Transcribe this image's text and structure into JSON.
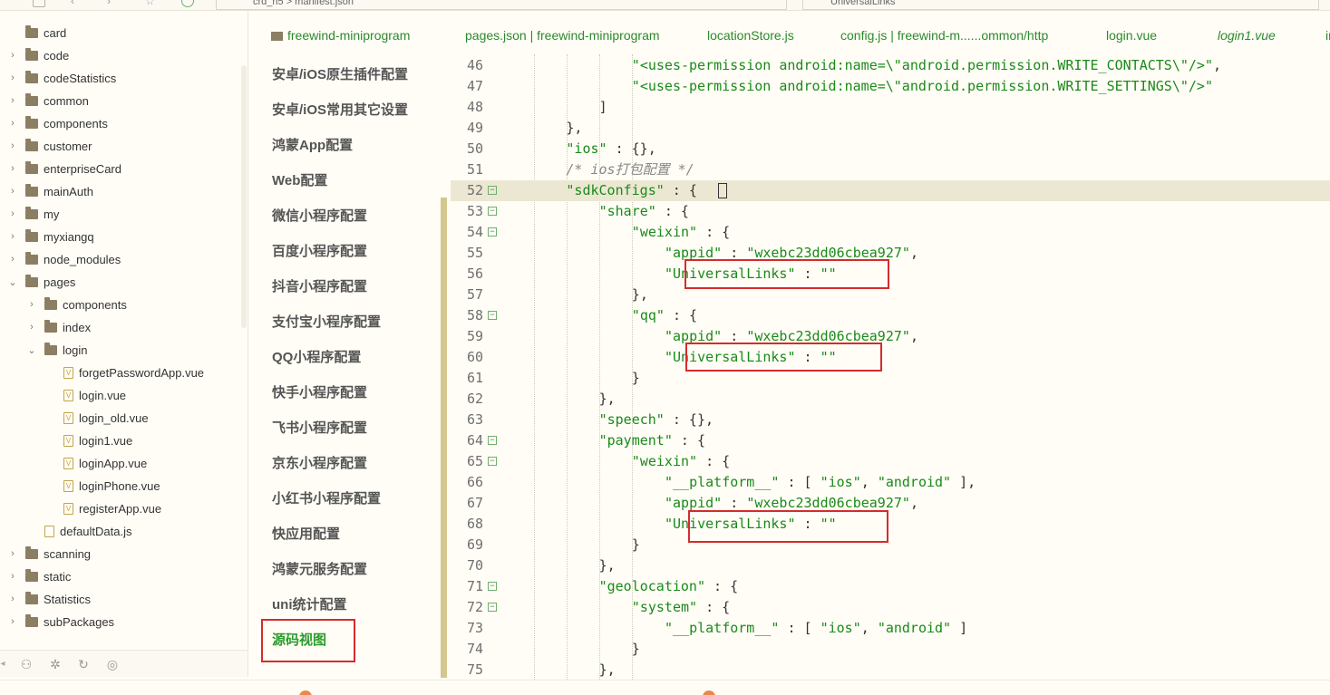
{
  "topbar": {
    "crumb": "crd_h5  >  manifest.json",
    "search": "UniversalLinks"
  },
  "tree": {
    "items": [
      {
        "label": "card",
        "type": "folder",
        "indent": 1,
        "expanded": null
      },
      {
        "label": "code",
        "type": "folder",
        "indent": 1,
        "expanded": false
      },
      {
        "label": "codeStatistics",
        "type": "folder",
        "indent": 1,
        "expanded": false
      },
      {
        "label": "common",
        "type": "folder",
        "indent": 1,
        "expanded": false
      },
      {
        "label": "components",
        "type": "folder",
        "indent": 1,
        "expanded": false
      },
      {
        "label": "customer",
        "type": "folder",
        "indent": 1,
        "expanded": false
      },
      {
        "label": "enterpriseCard",
        "type": "folder",
        "indent": 1,
        "expanded": false
      },
      {
        "label": "mainAuth",
        "type": "folder",
        "indent": 1,
        "expanded": false
      },
      {
        "label": "my",
        "type": "folder",
        "indent": 1,
        "expanded": false
      },
      {
        "label": "myxiangq",
        "type": "folder",
        "indent": 1,
        "expanded": false
      },
      {
        "label": "node_modules",
        "type": "folder",
        "indent": 1,
        "expanded": false
      },
      {
        "label": "pages",
        "type": "folder",
        "indent": 1,
        "expanded": true
      },
      {
        "label": "components",
        "type": "folder",
        "indent": 2,
        "expanded": false
      },
      {
        "label": "index",
        "type": "folder",
        "indent": 2,
        "expanded": false
      },
      {
        "label": "login",
        "type": "folder",
        "indent": 2,
        "expanded": true
      },
      {
        "label": "forgetPasswordApp.vue",
        "type": "file",
        "indent": 3,
        "expanded": null
      },
      {
        "label": "login.vue",
        "type": "file",
        "indent": 3,
        "expanded": null
      },
      {
        "label": "login_old.vue",
        "type": "file",
        "indent": 3,
        "expanded": null
      },
      {
        "label": "login1.vue",
        "type": "file",
        "indent": 3,
        "expanded": null
      },
      {
        "label": "loginApp.vue",
        "type": "file",
        "indent": 3,
        "expanded": null
      },
      {
        "label": "loginPhone.vue",
        "type": "file",
        "indent": 3,
        "expanded": null
      },
      {
        "label": "registerApp.vue",
        "type": "file",
        "indent": 3,
        "expanded": null
      },
      {
        "label": "defaultData.js",
        "type": "file",
        "indent": 2,
        "expanded": null
      },
      {
        "label": "scanning",
        "type": "folder",
        "indent": 1,
        "expanded": false
      },
      {
        "label": "static",
        "type": "folder",
        "indent": 1,
        "expanded": false
      },
      {
        "label": "Statistics",
        "type": "folder",
        "indent": 1,
        "expanded": false
      },
      {
        "label": "subPackages",
        "type": "folder",
        "indent": 1,
        "expanded": false
      }
    ]
  },
  "tabs": [
    {
      "label": "freewind-miniprogram",
      "italic": false,
      "icon": "folder-icon"
    },
    {
      "label": "pages.json | freewind-miniprogram",
      "italic": false,
      "icon": null
    },
    {
      "label": "locationStore.js",
      "italic": false,
      "icon": null
    },
    {
      "label": "config.js | freewind-m......ommon/http",
      "italic": false,
      "icon": null
    },
    {
      "label": "login.vue",
      "italic": false,
      "icon": null
    },
    {
      "label": "login1.vue",
      "italic": true,
      "icon": null
    },
    {
      "label": "in",
      "italic": false,
      "icon": null
    }
  ],
  "nav": {
    "items": [
      "安卓/iOS原生插件配置",
      "安卓/iOS常用其它设置",
      "鸿蒙App配置",
      "Web配置",
      "微信小程序配置",
      "百度小程序配置",
      "抖音小程序配置",
      "支付宝小程序配置",
      "QQ小程序配置",
      "快手小程序配置",
      "飞书小程序配置",
      "京东小程序配置",
      "小红书小程序配置",
      "快应用配置",
      "鸿蒙元服务配置",
      "uni统计配置",
      "源码视图"
    ],
    "active": "源码视图"
  },
  "editor": {
    "lines": [
      {
        "n": "46",
        "fold": false,
        "hl": false,
        "indent": 5,
        "segs": [
          [
            "s",
            "\"<uses-permission android:name=\\\"android.permission.WRITE_CONTACTS\\\"/>\""
          ],
          [
            "p",
            ","
          ]
        ]
      },
      {
        "n": "47",
        "fold": false,
        "hl": false,
        "indent": 5,
        "segs": [
          [
            "s",
            "\"<uses-permission android:name=\\\"android.permission.WRITE_SETTINGS\\\"/>\""
          ]
        ]
      },
      {
        "n": "48",
        "fold": false,
        "hl": false,
        "indent": 4,
        "segs": [
          [
            "p",
            "]"
          ]
        ]
      },
      {
        "n": "49",
        "fold": false,
        "hl": false,
        "indent": 3,
        "segs": [
          [
            "p",
            "},"
          ]
        ]
      },
      {
        "n": "50",
        "fold": false,
        "hl": false,
        "indent": 3,
        "segs": [
          [
            "s",
            "\"ios\""
          ],
          [
            "p",
            " : {},"
          ]
        ]
      },
      {
        "n": "51",
        "fold": false,
        "hl": false,
        "indent": 3,
        "segs": [
          [
            "c",
            "/* ios打包配置 */"
          ]
        ]
      },
      {
        "n": "52",
        "fold": true,
        "hl": true,
        "indent": 3,
        "segs": [
          [
            "s",
            "\"sdkConfigs\""
          ],
          [
            "p",
            " : {"
          ]
        ]
      },
      {
        "n": "53",
        "fold": true,
        "hl": false,
        "indent": 4,
        "segs": [
          [
            "s",
            "\"share\""
          ],
          [
            "p",
            " : {"
          ]
        ]
      },
      {
        "n": "54",
        "fold": true,
        "hl": false,
        "indent": 5,
        "segs": [
          [
            "s",
            "\"weixin\""
          ],
          [
            "p",
            " : {"
          ]
        ]
      },
      {
        "n": "55",
        "fold": false,
        "hl": false,
        "indent": 6,
        "segs": [
          [
            "s",
            "\"appid\""
          ],
          [
            "p",
            " : "
          ],
          [
            "s",
            "\"wxebc23dd06cbea927\""
          ],
          [
            "p",
            ","
          ]
        ]
      },
      {
        "n": "56",
        "fold": false,
        "hl": false,
        "indent": 6,
        "segs": [
          [
            "s",
            "\"UniversalLinks\""
          ],
          [
            "p",
            " : "
          ],
          [
            "s",
            "\"\""
          ]
        ]
      },
      {
        "n": "57",
        "fold": false,
        "hl": false,
        "indent": 5,
        "segs": [
          [
            "p",
            "},"
          ]
        ]
      },
      {
        "n": "58",
        "fold": true,
        "hl": false,
        "indent": 5,
        "segs": [
          [
            "s",
            "\"qq\""
          ],
          [
            "p",
            " : {"
          ]
        ]
      },
      {
        "n": "59",
        "fold": false,
        "hl": false,
        "indent": 6,
        "segs": [
          [
            "s",
            "\"appid\""
          ],
          [
            "p",
            " : "
          ],
          [
            "s",
            "\"wxebc23dd06cbea927\""
          ],
          [
            "p",
            ","
          ]
        ]
      },
      {
        "n": "60",
        "fold": false,
        "hl": false,
        "indent": 6,
        "segs": [
          [
            "s",
            "\"UniversalLinks\""
          ],
          [
            "p",
            " : "
          ],
          [
            "s",
            "\"\""
          ]
        ]
      },
      {
        "n": "61",
        "fold": false,
        "hl": false,
        "indent": 5,
        "segs": [
          [
            "p",
            "}"
          ]
        ]
      },
      {
        "n": "62",
        "fold": false,
        "hl": false,
        "indent": 4,
        "segs": [
          [
            "p",
            "},"
          ]
        ]
      },
      {
        "n": "63",
        "fold": false,
        "hl": false,
        "indent": 4,
        "segs": [
          [
            "s",
            "\"speech\""
          ],
          [
            "p",
            " : {},"
          ]
        ]
      },
      {
        "n": "64",
        "fold": true,
        "hl": false,
        "indent": 4,
        "segs": [
          [
            "s",
            "\"payment\""
          ],
          [
            "p",
            " : {"
          ]
        ]
      },
      {
        "n": "65",
        "fold": true,
        "hl": false,
        "indent": 5,
        "segs": [
          [
            "s",
            "\"weixin\""
          ],
          [
            "p",
            " : {"
          ]
        ]
      },
      {
        "n": "66",
        "fold": false,
        "hl": false,
        "indent": 6,
        "segs": [
          [
            "s",
            "\"__platform__\""
          ],
          [
            "p",
            " : [ "
          ],
          [
            "s",
            "\"ios\""
          ],
          [
            "p",
            ", "
          ],
          [
            "s",
            "\"android\""
          ],
          [
            "p",
            " ],"
          ]
        ]
      },
      {
        "n": "67",
        "fold": false,
        "hl": false,
        "indent": 6,
        "segs": [
          [
            "s",
            "\"appid\""
          ],
          [
            "p",
            " : "
          ],
          [
            "s",
            "\"wxebc23dd06cbea927\""
          ],
          [
            "p",
            ","
          ]
        ]
      },
      {
        "n": "68",
        "fold": false,
        "hl": false,
        "indent": 6,
        "segs": [
          [
            "s",
            "\"UniversalLinks\""
          ],
          [
            "p",
            " : "
          ],
          [
            "s",
            "\"\""
          ]
        ]
      },
      {
        "n": "69",
        "fold": false,
        "hl": false,
        "indent": 5,
        "segs": [
          [
            "p",
            "}"
          ]
        ]
      },
      {
        "n": "70",
        "fold": false,
        "hl": false,
        "indent": 4,
        "segs": [
          [
            "p",
            "},"
          ]
        ]
      },
      {
        "n": "71",
        "fold": true,
        "hl": false,
        "indent": 4,
        "segs": [
          [
            "s",
            "\"geolocation\""
          ],
          [
            "p",
            " : {"
          ]
        ]
      },
      {
        "n": "72",
        "fold": true,
        "hl": false,
        "indent": 5,
        "segs": [
          [
            "s",
            "\"system\""
          ],
          [
            "p",
            " : {"
          ]
        ]
      },
      {
        "n": "73",
        "fold": false,
        "hl": false,
        "indent": 6,
        "segs": [
          [
            "s",
            "\"__platform__\""
          ],
          [
            "p",
            " : [ "
          ],
          [
            "s",
            "\"ios\""
          ],
          [
            "p",
            ", "
          ],
          [
            "s",
            "\"android\""
          ],
          [
            "p",
            " ]"
          ]
        ]
      },
      {
        "n": "74",
        "fold": false,
        "hl": false,
        "indent": 5,
        "segs": [
          [
            "p",
            "}"
          ]
        ]
      },
      {
        "n": "75",
        "fold": false,
        "hl": false,
        "indent": 4,
        "segs": [
          [
            "p",
            "},"
          ]
        ]
      }
    ]
  },
  "colors": {
    "accent_green": "#2b9b2b",
    "highlight_red": "#d42c2c"
  }
}
